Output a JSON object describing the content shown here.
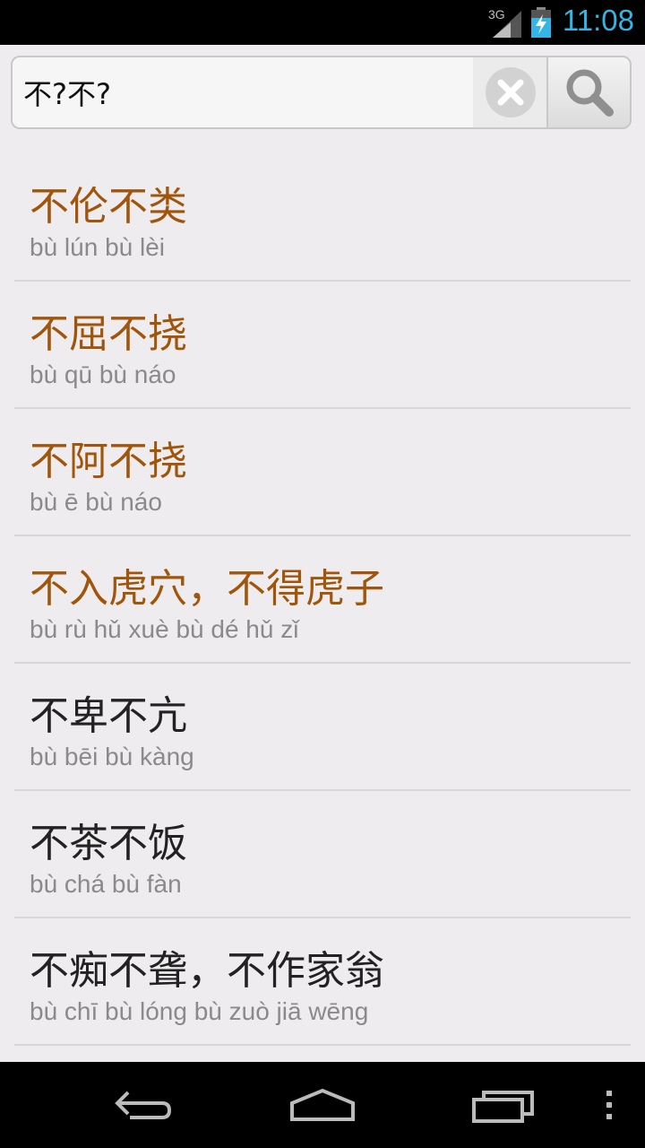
{
  "status_bar": {
    "network": "3G",
    "time": "11:08",
    "time_color": "#33b5e5"
  },
  "search": {
    "value": "不?不?",
    "clear_icon": "clear-icon",
    "search_icon": "search-icon"
  },
  "results": [
    {
      "title": "不伦不类",
      "pinyin": "bù lún bù lèi",
      "highlighted": true
    },
    {
      "title": "不屈不挠",
      "pinyin": "bù qū bù náo",
      "highlighted": true
    },
    {
      "title": "不阿不挠",
      "pinyin": "bù ē bù náo",
      "highlighted": true
    },
    {
      "title": "不入虎穴，不得虎子",
      "pinyin": "bù rù hǔ xuè bù dé hǔ zǐ",
      "highlighted": true
    },
    {
      "title": "不卑不亢",
      "pinyin": "bù bēi bù kàng",
      "highlighted": false
    },
    {
      "title": "不茶不饭",
      "pinyin": "bù chá bù fàn",
      "highlighted": false
    },
    {
      "title": "不痴不聋，不作家翁",
      "pinyin": "bù chī bù lóng bù zuò jiā wēng",
      "highlighted": false
    }
  ],
  "colors": {
    "highlight": "#a0550a",
    "normal_title": "#222222",
    "pinyin": "#8a8a8a",
    "background": "#efecef"
  },
  "nav_bar": {
    "back_icon": "back-icon",
    "home_icon": "home-icon",
    "recents_icon": "recents-icon",
    "menu_icon": "overflow-menu-icon"
  }
}
